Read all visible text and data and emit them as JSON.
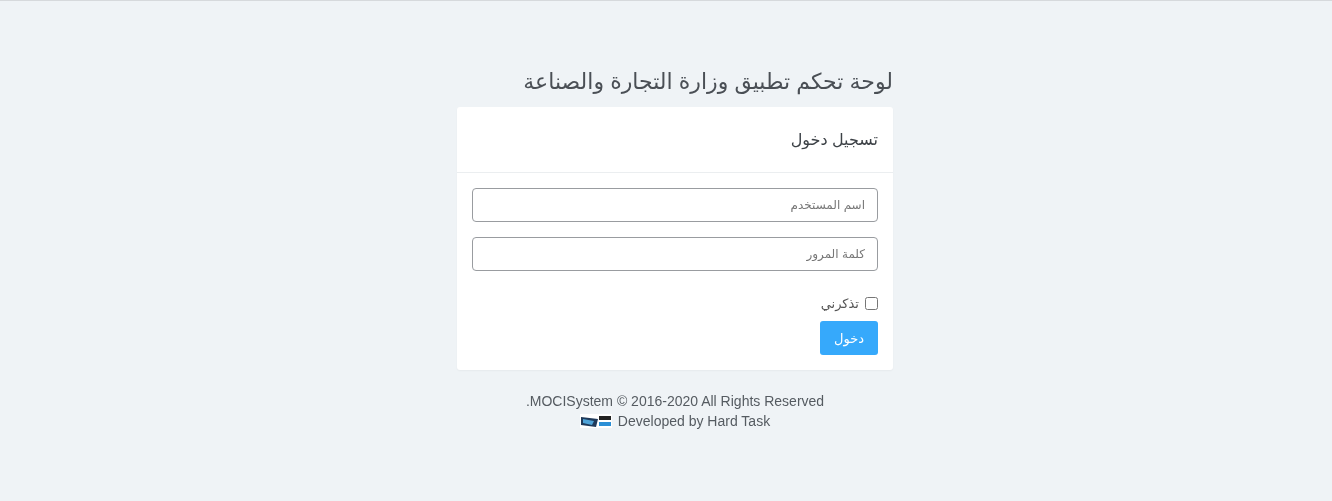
{
  "page_title": "لوحة تحكم تطبيق وزارة التجارة والصناعة",
  "login_card": {
    "header": "تسجيل دخول",
    "username_field": {
      "placeholder": "اسم المستخدم"
    },
    "password_field": {
      "placeholder": "كلمة المرور"
    },
    "remember_me": {
      "label": "تذكرني",
      "checked": false
    },
    "submit_button": "دخول"
  },
  "footer": {
    "copyright": "MOCISystem © 2016-2020 All Rights Reserved.",
    "developer": "Developed by Hard Task"
  }
}
